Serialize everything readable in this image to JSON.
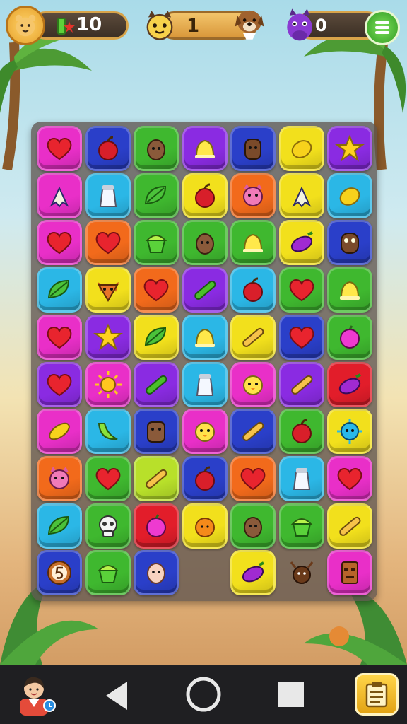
{
  "hud": {
    "energy_value": "10",
    "score_value": "1",
    "rival_value": "0"
  },
  "colors": {
    "magenta": "#e92fc8",
    "blue": "#2a3fc9",
    "green": "#3fb82f",
    "purple": "#8a2be2",
    "yellow": "#f2e01c",
    "cyan": "#2bb7e6",
    "orange": "#f26a1b",
    "red": "#e21d2a",
    "lime": "#b8e02a"
  },
  "board": {
    "rows": [
      [
        [
          "magenta",
          "heart-icon"
        ],
        [
          "blue",
          "apple-icon"
        ],
        [
          "green",
          "acorn-face-icon"
        ],
        [
          "purple",
          "bell-icon"
        ],
        [
          "blue",
          "barrel-icon"
        ],
        [
          "yellow",
          "lemon-icon"
        ],
        [
          "purple",
          "star-icon"
        ]
      ],
      [
        [
          "magenta",
          "banana-peel-icon"
        ],
        [
          "cyan",
          "salt-shaker-icon"
        ],
        [
          "green",
          "leaf-icon"
        ],
        [
          "yellow",
          "apple-icon"
        ],
        [
          "orange",
          "cat-face-icon"
        ],
        [
          "yellow",
          "banana-peel-icon"
        ],
        [
          "cyan",
          "lemon-icon"
        ]
      ],
      [
        [
          "magenta",
          "heart-icon"
        ],
        [
          "orange",
          "heart-icon"
        ],
        [
          "green",
          "cupcake-icon"
        ],
        [
          "green",
          "acorn-face-icon"
        ],
        [
          "green",
          "bell-icon"
        ],
        [
          "yellow",
          "eggplant-icon"
        ],
        [
          "blue",
          "owl-icon"
        ]
      ],
      [
        [
          "cyan",
          "leaf-icon"
        ],
        [
          "yellow",
          "fox-face-icon"
        ],
        [
          "orange",
          "heart-icon"
        ],
        [
          "purple",
          "cucumber-icon"
        ],
        [
          "cyan",
          "apple-icon"
        ],
        [
          "green",
          "heart-icon"
        ],
        [
          "green",
          "bell-icon"
        ]
      ],
      [
        [
          "magenta",
          "heart-icon"
        ],
        [
          "purple",
          "star-icon"
        ],
        [
          "yellow",
          "leaf-icon"
        ],
        [
          "cyan",
          "bell-icon"
        ],
        [
          "yellow",
          "rolling-pin-icon"
        ],
        [
          "blue",
          "heart-icon"
        ],
        [
          "green",
          "plum-icon"
        ]
      ],
      [
        [
          "purple",
          "heart-icon"
        ],
        [
          "magenta",
          "sun-icon"
        ],
        [
          "purple",
          "cucumber-icon"
        ],
        [
          "cyan",
          "salt-shaker-icon"
        ],
        [
          "magenta",
          "chick-face-icon"
        ],
        [
          "purple",
          "rolling-pin-icon"
        ],
        [
          "red",
          "eggplant-icon"
        ]
      ],
      [
        [
          "magenta",
          "corn-icon"
        ],
        [
          "cyan",
          "banana-icon"
        ],
        [
          "blue",
          "dog-face-icon"
        ],
        [
          "magenta",
          "chick-face-icon"
        ],
        [
          "blue",
          "rolling-pin-icon"
        ],
        [
          "green",
          "apple-icon"
        ],
        [
          "yellow",
          "sun-monster-icon"
        ]
      ],
      [
        [
          "orange",
          "cat-face-icon"
        ],
        [
          "green",
          "heart-icon"
        ],
        [
          "lime",
          "rolling-pin-icon"
        ],
        [
          "blue",
          "apple-icon"
        ],
        [
          "orange",
          "heart-icon"
        ],
        [
          "cyan",
          "salt-shaker-icon"
        ],
        [
          "magenta",
          "heart-icon"
        ]
      ],
      [
        [
          "cyan",
          "leaf-icon"
        ],
        [
          "green",
          "skull-icon"
        ],
        [
          "red",
          "plum-icon"
        ],
        [
          "yellow",
          "orange-fruit-icon"
        ],
        [
          "green",
          "acorn-face-icon"
        ],
        [
          "green",
          "cupcake-icon"
        ],
        [
          "yellow",
          "rolling-pin-icon"
        ]
      ],
      [
        [
          "blue",
          "coin-five-icon"
        ],
        [
          "green",
          "cupcake-icon"
        ],
        [
          "blue",
          "face-icon"
        ],
        [
          "",
          ""
        ],
        [
          "yellow",
          "eggplant-icon"
        ],
        [
          "",
          "reindeer-icon"
        ],
        [
          "magenta",
          "tiki-icon"
        ]
      ]
    ]
  }
}
